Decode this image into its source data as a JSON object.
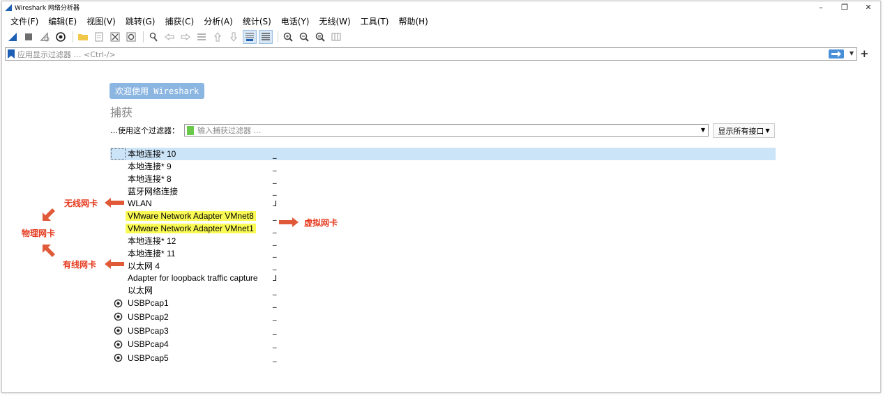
{
  "window": {
    "title": "Wireshark 网络分析器"
  },
  "window_controls": [
    "–",
    "❐",
    "✕"
  ],
  "menu": [
    "文件(F)",
    "编辑(E)",
    "视图(V)",
    "跳转(G)",
    "捕获(C)",
    "分析(A)",
    "统计(S)",
    "电话(Y)",
    "无线(W)",
    "工具(T)",
    "帮助(H)"
  ],
  "toolbar": {
    "icons": [
      "shark-fin-start-icon",
      "stop-square-icon",
      "restart-icon",
      "capture-options-gear-icon",
      "open-folder-icon",
      "file-icon",
      "close-file-icon",
      "reload-icon",
      "find-icon",
      "back-arrow-icon",
      "forward-arrow-icon",
      "goto-packet-icon",
      "first-packet-icon",
      "last-packet-icon",
      "autoscroll-icon",
      "colorize-icon",
      "zoom-in-icon",
      "zoom-out-icon",
      "zoom-normal-icon",
      "resize-columns-icon"
    ]
  },
  "display_filter": {
    "placeholder": "应用显示过滤器 … <Ctrl-/>"
  },
  "welcome": {
    "label": "欢迎使用 Wireshark"
  },
  "capture": {
    "heading": "捕获",
    "filter_label": "…使用这个过滤器：",
    "filter_placeholder": "输入捕获过滤器 …",
    "show_interfaces": "显示所有接口"
  },
  "interfaces": [
    {
      "name": "本地连接* 10",
      "spark": "_"
    },
    {
      "name": "本地连接* 9",
      "spark": "_"
    },
    {
      "name": "本地连接* 8",
      "spark": "_"
    },
    {
      "name": "蓝牙网络连接",
      "spark": "_"
    },
    {
      "name": "WLAN",
      "spark": "⅃"
    },
    {
      "name": "VMware Network Adapter VMnet8",
      "spark": "_"
    },
    {
      "name": "VMware Network Adapter VMnet1",
      "spark": "_"
    },
    {
      "name": "本地连接* 12",
      "spark": "_"
    },
    {
      "name": "本地连接* 11",
      "spark": "_"
    },
    {
      "name": "以太网 4",
      "spark": "_"
    },
    {
      "name": "Adapter for loopback traffic capture",
      "spark": "⅃"
    },
    {
      "name": "以太网",
      "spark": "_"
    }
  ],
  "usb_interfaces": [
    {
      "name": "USBPcap1",
      "spark": "_"
    },
    {
      "name": "USBPcap2",
      "spark": "_"
    },
    {
      "name": "USBPcap3",
      "spark": "_"
    },
    {
      "name": "USBPcap4",
      "spark": "_"
    },
    {
      "name": "USBPcap5",
      "spark": "_"
    }
  ],
  "annotations": {
    "wireless": "无线网卡",
    "physical": "物理网卡",
    "wired": "有线网卡",
    "virtual": "虚拟网卡"
  },
  "colors": {
    "annotation": "#e53a1e",
    "highlight": "#fafa55",
    "selected_row": "#cce4f7",
    "welcome_bg": "#8cb6e2"
  }
}
